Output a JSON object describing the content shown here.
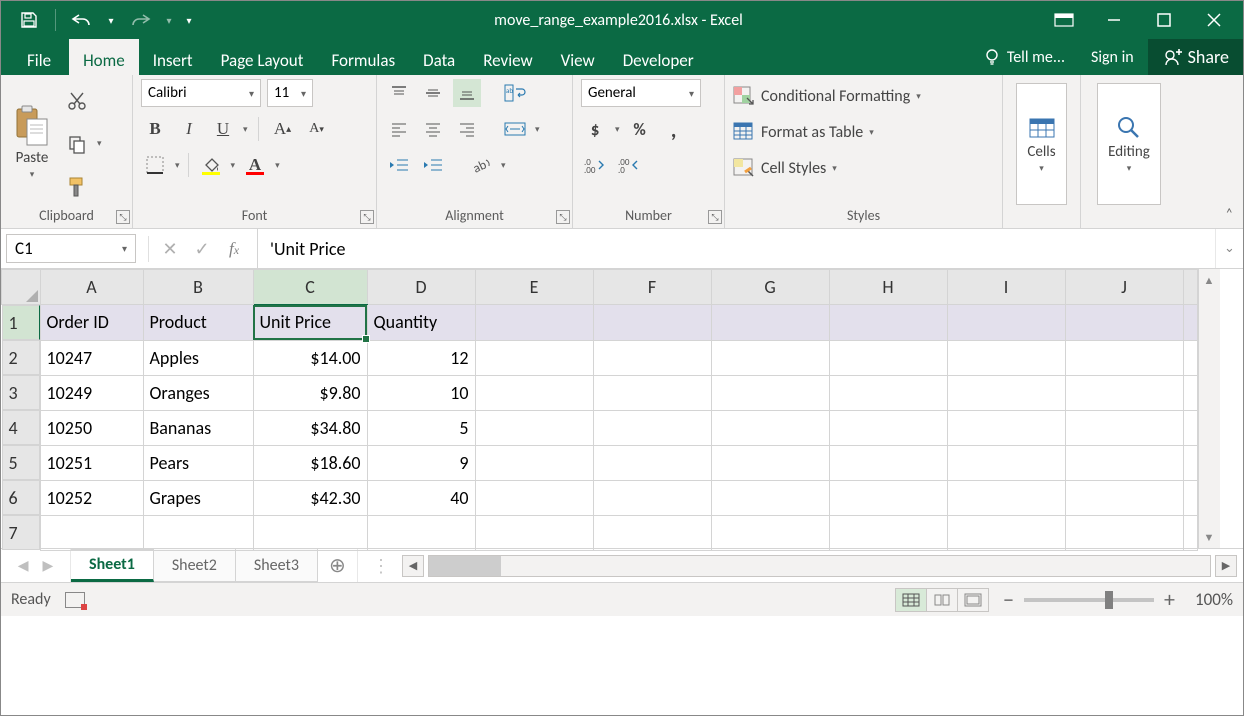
{
  "title": "move_range_example2016.xlsx - Excel",
  "tabs": {
    "file": "File",
    "home": "Home",
    "insert": "Insert",
    "pagelayout": "Page Layout",
    "formulas": "Formulas",
    "data": "Data",
    "review": "Review",
    "view": "View",
    "developer": "Developer",
    "tellme": "Tell me...",
    "signin": "Sign in",
    "share": "Share"
  },
  "ribbon": {
    "clipboard": {
      "paste": "Paste",
      "label": "Clipboard"
    },
    "font": {
      "name": "Calibri",
      "size": "11",
      "label": "Font"
    },
    "alignment": {
      "label": "Alignment"
    },
    "number": {
      "format": "General",
      "label": "Number"
    },
    "styles": {
      "cond": "Conditional Formatting",
      "table": "Format as Table",
      "cell": "Cell Styles",
      "label": "Styles"
    },
    "cells": {
      "label": "Cells"
    },
    "editing": {
      "label": "Editing"
    }
  },
  "fxbar": {
    "namebox": "C1",
    "formula": "'Unit Price"
  },
  "grid": {
    "cols": [
      "A",
      "B",
      "C",
      "D",
      "E",
      "F",
      "G",
      "H",
      "I",
      "J"
    ],
    "rows": [
      "1",
      "2",
      "3",
      "4",
      "5",
      "6",
      "7"
    ],
    "selected_cell": "C1",
    "headers": [
      "Order ID",
      "Product",
      "Unit Price",
      "Quantity"
    ],
    "data": [
      [
        "10247",
        "Apples",
        "$14.00",
        "12"
      ],
      [
        "10249",
        "Oranges",
        "$9.80",
        "10"
      ],
      [
        "10250",
        "Bananas",
        "$34.80",
        "5"
      ],
      [
        "10251",
        "Pears",
        "$18.60",
        "9"
      ],
      [
        "10252",
        "Grapes",
        "$42.30",
        "40"
      ]
    ]
  },
  "sheets": {
    "active": "Sheet1",
    "tabs": [
      "Sheet1",
      "Sheet2",
      "Sheet3"
    ]
  },
  "status": {
    "mode": "Ready",
    "zoom": "100%"
  }
}
